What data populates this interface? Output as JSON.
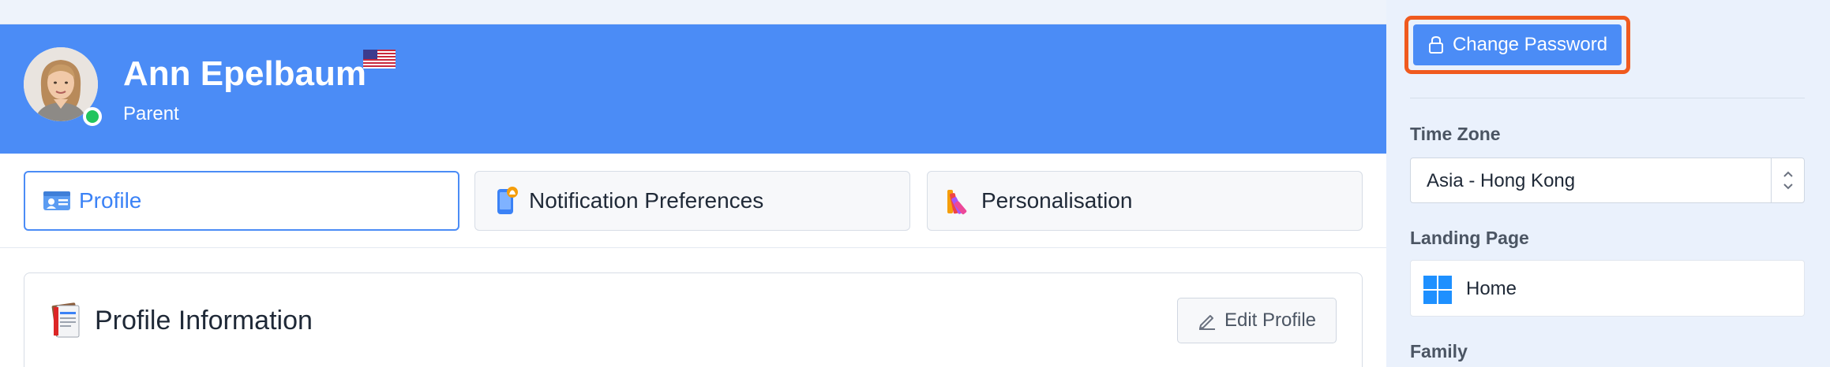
{
  "profile": {
    "name": "Ann Epelbaum",
    "role": "Parent",
    "status": "online",
    "flag_icon": "us-flag-icon"
  },
  "tabs": [
    {
      "label": "Profile",
      "icon": "id-card-icon",
      "active": true
    },
    {
      "label": "Notification Preferences",
      "icon": "phone-notification-icon",
      "active": false
    },
    {
      "label": "Personalisation",
      "icon": "color-palette-icon",
      "active": false
    }
  ],
  "section": {
    "title": "Profile Information",
    "icon": "notebook-icon",
    "edit_label": "Edit Profile"
  },
  "sidebar": {
    "change_password_label": "Change Password",
    "timezone": {
      "label": "Time Zone",
      "value": "Asia - Hong Kong"
    },
    "landing_page": {
      "label": "Landing Page",
      "value": "Home",
      "icon": "windows-grid-icon"
    },
    "family_label": "Family"
  },
  "colors": {
    "accent": "#4b8cf6",
    "highlight": "#f05a1e",
    "online": "#22c55e"
  }
}
